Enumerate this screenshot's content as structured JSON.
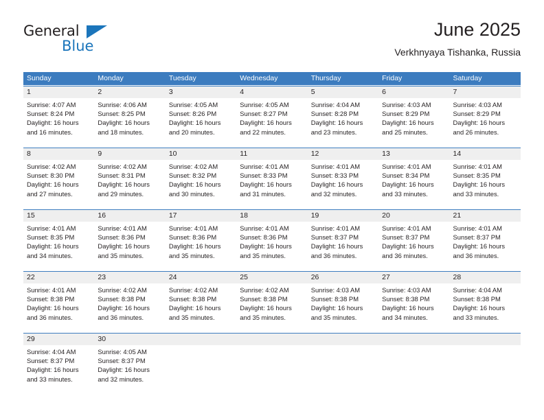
{
  "brand": {
    "name_part1": "General",
    "name_part2": "Blue",
    "accent_color": "#1b75bb"
  },
  "header": {
    "title": "June 2025",
    "subtitle": "Verkhnyaya Tishanka, Russia"
  },
  "calendar": {
    "header_bg": "#3c7cbf",
    "datebar_bg": "#efefef",
    "weekdays": [
      "Sunday",
      "Monday",
      "Tuesday",
      "Wednesday",
      "Thursday",
      "Friday",
      "Saturday"
    ],
    "weeks": [
      [
        {
          "day": "1",
          "sunrise": "Sunrise: 4:07 AM",
          "sunset": "Sunset: 8:24 PM",
          "daylight_line1": "Daylight: 16 hours",
          "daylight_line2": "and 16 minutes."
        },
        {
          "day": "2",
          "sunrise": "Sunrise: 4:06 AM",
          "sunset": "Sunset: 8:25 PM",
          "daylight_line1": "Daylight: 16 hours",
          "daylight_line2": "and 18 minutes."
        },
        {
          "day": "3",
          "sunrise": "Sunrise: 4:05 AM",
          "sunset": "Sunset: 8:26 PM",
          "daylight_line1": "Daylight: 16 hours",
          "daylight_line2": "and 20 minutes."
        },
        {
          "day": "4",
          "sunrise": "Sunrise: 4:05 AM",
          "sunset": "Sunset: 8:27 PM",
          "daylight_line1": "Daylight: 16 hours",
          "daylight_line2": "and 22 minutes."
        },
        {
          "day": "5",
          "sunrise": "Sunrise: 4:04 AM",
          "sunset": "Sunset: 8:28 PM",
          "daylight_line1": "Daylight: 16 hours",
          "daylight_line2": "and 23 minutes."
        },
        {
          "day": "6",
          "sunrise": "Sunrise: 4:03 AM",
          "sunset": "Sunset: 8:29 PM",
          "daylight_line1": "Daylight: 16 hours",
          "daylight_line2": "and 25 minutes."
        },
        {
          "day": "7",
          "sunrise": "Sunrise: 4:03 AM",
          "sunset": "Sunset: 8:29 PM",
          "daylight_line1": "Daylight: 16 hours",
          "daylight_line2": "and 26 minutes."
        }
      ],
      [
        {
          "day": "8",
          "sunrise": "Sunrise: 4:02 AM",
          "sunset": "Sunset: 8:30 PM",
          "daylight_line1": "Daylight: 16 hours",
          "daylight_line2": "and 27 minutes."
        },
        {
          "day": "9",
          "sunrise": "Sunrise: 4:02 AM",
          "sunset": "Sunset: 8:31 PM",
          "daylight_line1": "Daylight: 16 hours",
          "daylight_line2": "and 29 minutes."
        },
        {
          "day": "10",
          "sunrise": "Sunrise: 4:02 AM",
          "sunset": "Sunset: 8:32 PM",
          "daylight_line1": "Daylight: 16 hours",
          "daylight_line2": "and 30 minutes."
        },
        {
          "day": "11",
          "sunrise": "Sunrise: 4:01 AM",
          "sunset": "Sunset: 8:33 PM",
          "daylight_line1": "Daylight: 16 hours",
          "daylight_line2": "and 31 minutes."
        },
        {
          "day": "12",
          "sunrise": "Sunrise: 4:01 AM",
          "sunset": "Sunset: 8:33 PM",
          "daylight_line1": "Daylight: 16 hours",
          "daylight_line2": "and 32 minutes."
        },
        {
          "day": "13",
          "sunrise": "Sunrise: 4:01 AM",
          "sunset": "Sunset: 8:34 PM",
          "daylight_line1": "Daylight: 16 hours",
          "daylight_line2": "and 33 minutes."
        },
        {
          "day": "14",
          "sunrise": "Sunrise: 4:01 AM",
          "sunset": "Sunset: 8:35 PM",
          "daylight_line1": "Daylight: 16 hours",
          "daylight_line2": "and 33 minutes."
        }
      ],
      [
        {
          "day": "15",
          "sunrise": "Sunrise: 4:01 AM",
          "sunset": "Sunset: 8:35 PM",
          "daylight_line1": "Daylight: 16 hours",
          "daylight_line2": "and 34 minutes."
        },
        {
          "day": "16",
          "sunrise": "Sunrise: 4:01 AM",
          "sunset": "Sunset: 8:36 PM",
          "daylight_line1": "Daylight: 16 hours",
          "daylight_line2": "and 35 minutes."
        },
        {
          "day": "17",
          "sunrise": "Sunrise: 4:01 AM",
          "sunset": "Sunset: 8:36 PM",
          "daylight_line1": "Daylight: 16 hours",
          "daylight_line2": "and 35 minutes."
        },
        {
          "day": "18",
          "sunrise": "Sunrise: 4:01 AM",
          "sunset": "Sunset: 8:36 PM",
          "daylight_line1": "Daylight: 16 hours",
          "daylight_line2": "and 35 minutes."
        },
        {
          "day": "19",
          "sunrise": "Sunrise: 4:01 AM",
          "sunset": "Sunset: 8:37 PM",
          "daylight_line1": "Daylight: 16 hours",
          "daylight_line2": "and 36 minutes."
        },
        {
          "day": "20",
          "sunrise": "Sunrise: 4:01 AM",
          "sunset": "Sunset: 8:37 PM",
          "daylight_line1": "Daylight: 16 hours",
          "daylight_line2": "and 36 minutes."
        },
        {
          "day": "21",
          "sunrise": "Sunrise: 4:01 AM",
          "sunset": "Sunset: 8:37 PM",
          "daylight_line1": "Daylight: 16 hours",
          "daylight_line2": "and 36 minutes."
        }
      ],
      [
        {
          "day": "22",
          "sunrise": "Sunrise: 4:01 AM",
          "sunset": "Sunset: 8:38 PM",
          "daylight_line1": "Daylight: 16 hours",
          "daylight_line2": "and 36 minutes."
        },
        {
          "day": "23",
          "sunrise": "Sunrise: 4:02 AM",
          "sunset": "Sunset: 8:38 PM",
          "daylight_line1": "Daylight: 16 hours",
          "daylight_line2": "and 36 minutes."
        },
        {
          "day": "24",
          "sunrise": "Sunrise: 4:02 AM",
          "sunset": "Sunset: 8:38 PM",
          "daylight_line1": "Daylight: 16 hours",
          "daylight_line2": "and 35 minutes."
        },
        {
          "day": "25",
          "sunrise": "Sunrise: 4:02 AM",
          "sunset": "Sunset: 8:38 PM",
          "daylight_line1": "Daylight: 16 hours",
          "daylight_line2": "and 35 minutes."
        },
        {
          "day": "26",
          "sunrise": "Sunrise: 4:03 AM",
          "sunset": "Sunset: 8:38 PM",
          "daylight_line1": "Daylight: 16 hours",
          "daylight_line2": "and 35 minutes."
        },
        {
          "day": "27",
          "sunrise": "Sunrise: 4:03 AM",
          "sunset": "Sunset: 8:38 PM",
          "daylight_line1": "Daylight: 16 hours",
          "daylight_line2": "and 34 minutes."
        },
        {
          "day": "28",
          "sunrise": "Sunrise: 4:04 AM",
          "sunset": "Sunset: 8:38 PM",
          "daylight_line1": "Daylight: 16 hours",
          "daylight_line2": "and 33 minutes."
        }
      ],
      [
        {
          "day": "29",
          "sunrise": "Sunrise: 4:04 AM",
          "sunset": "Sunset: 8:37 PM",
          "daylight_line1": "Daylight: 16 hours",
          "daylight_line2": "and 33 minutes."
        },
        {
          "day": "30",
          "sunrise": "Sunrise: 4:05 AM",
          "sunset": "Sunset: 8:37 PM",
          "daylight_line1": "Daylight: 16 hours",
          "daylight_line2": "and 32 minutes."
        },
        {
          "day": "",
          "sunrise": "",
          "sunset": "",
          "daylight_line1": "",
          "daylight_line2": ""
        },
        {
          "day": "",
          "sunrise": "",
          "sunset": "",
          "daylight_line1": "",
          "daylight_line2": ""
        },
        {
          "day": "",
          "sunrise": "",
          "sunset": "",
          "daylight_line1": "",
          "daylight_line2": ""
        },
        {
          "day": "",
          "sunrise": "",
          "sunset": "",
          "daylight_line1": "",
          "daylight_line2": ""
        },
        {
          "day": "",
          "sunrise": "",
          "sunset": "",
          "daylight_line1": "",
          "daylight_line2": ""
        }
      ]
    ]
  }
}
